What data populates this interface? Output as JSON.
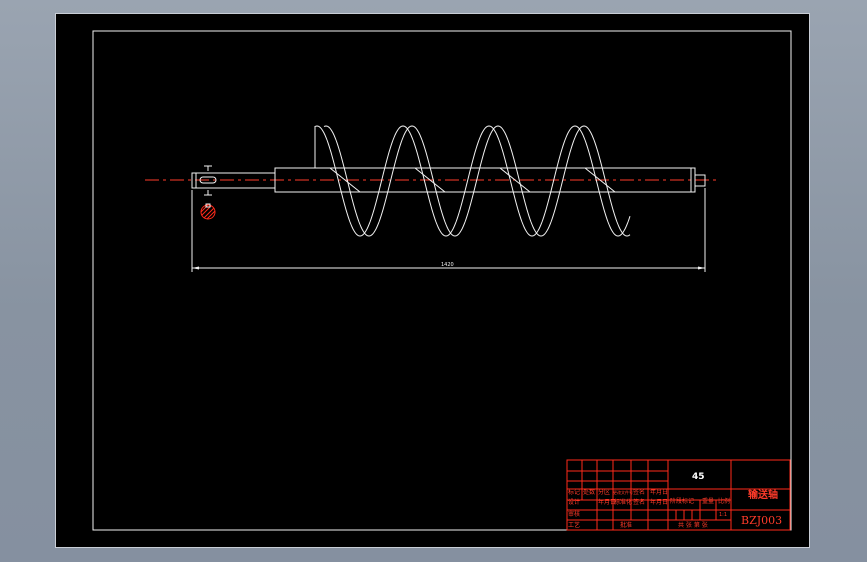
{
  "drawing": {
    "dimension_label": "1420",
    "colors": {
      "background": "#8b96a4",
      "sheet": "#000000",
      "outline": "#f2f2f2",
      "centerline": "#ff3b2a",
      "title_block": "#ff2a1a"
    }
  },
  "title_block": {
    "material": "45",
    "part_name": "输送轴",
    "drawing_number": "BZJ003",
    "scale": "1:1",
    "revision_headers": [
      "标记",
      "处数",
      "分区",
      "更改文件号",
      "签名",
      "年月日"
    ],
    "labels": {
      "design": "设计",
      "date": "年月日",
      "standardization": "标准化",
      "signature": "签名",
      "date2": "年月日",
      "stage_mark": "阶段标记",
      "weight": "重量",
      "ratio": "比例",
      "review": "审核",
      "process": "工艺",
      "approve": "批准",
      "sheets": "共  张  第  张"
    }
  }
}
